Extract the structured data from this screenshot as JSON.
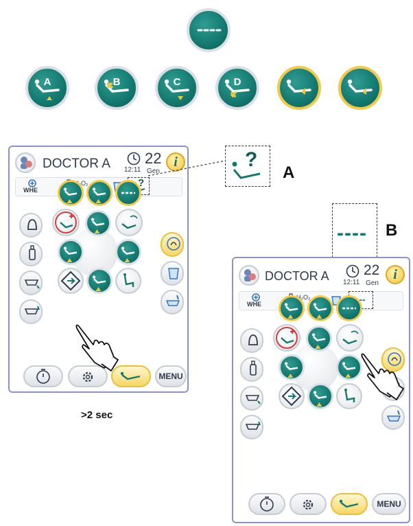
{
  "top_buttons": {
    "memory": {
      "icon": "dashes-icon"
    },
    "positions": [
      {
        "letter": "A",
        "icon": "chair-position-icon",
        "ring": "grey"
      },
      {
        "letter": "B",
        "icon": "chair-position-icon",
        "ring": "grey"
      },
      {
        "letter": "C",
        "icon": "chair-position-icon",
        "ring": "grey"
      },
      {
        "letter": "D",
        "icon": "chair-position-icon",
        "ring": "grey"
      },
      {
        "letter": "",
        "icon": "chair-rinse-icon",
        "ring": "gold"
      },
      {
        "letter": "",
        "icon": "chair-last-position-icon",
        "ring": "gold"
      }
    ]
  },
  "left_panel": {
    "doctor": "DOCTOR A",
    "time": "12:11",
    "number": "22",
    "gen": "Gen",
    "info": "i",
    "whe": "WHE",
    "h2o2": "H₂O₂",
    "slot_symbol": "?",
    "menu": "MENU"
  },
  "right_panel": {
    "doctor": "DOCTOR A",
    "time": "12:11",
    "number": "22",
    "gen": "Gen",
    "info": "i",
    "whe": "WHE",
    "h2o2": "H₂O₂",
    "slot_symbol": "----",
    "menu": "MENU"
  },
  "callouts": {
    "a_letter": "A",
    "a_symbol": "?",
    "b_letter": "B",
    "b_symbol": "----"
  },
  "caption": ">2 sec",
  "colors": {
    "teal": "#13786f",
    "gold": "#f3c94a",
    "panel_border": "#8c91c6"
  }
}
